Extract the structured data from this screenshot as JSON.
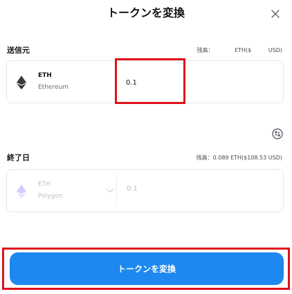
{
  "header": {
    "title": "トークンを変換"
  },
  "icons": {
    "close": "close-icon",
    "ethereum": "ethereum-icon",
    "swap_direction": "swap-direction-icon",
    "chevron": "chevron-down-icon"
  },
  "from_section": {
    "label": "送信元",
    "balance_label": "残高：",
    "balance_unit": "ETH($",
    "balance_unit_suffix": "USD)",
    "token_symbol": "ETH",
    "token_network": "Ethereum",
    "amount": "0.1"
  },
  "to_section": {
    "label": "終了日",
    "balance_text": "残高：0.089 ETH($108.53 USD)",
    "token_symbol": "ETH",
    "token_network": "Polygon",
    "amount": "0.1"
  },
  "submit": {
    "label": "トークンを変換"
  },
  "colors": {
    "accent": "#1e88f0",
    "highlight": "#e0111d",
    "ethereum_icon": "#2c2c2c",
    "polygon_icon": "#a78bfa"
  }
}
